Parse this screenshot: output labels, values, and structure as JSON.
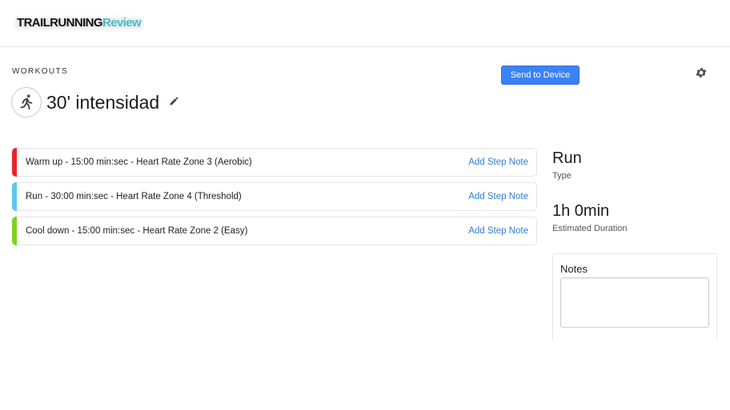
{
  "header": {
    "logo_part1": "TRAILRUNNING",
    "logo_part2": "Review"
  },
  "section_label": "WORKOUTS",
  "send_button_label": "Send to Device",
  "workout": {
    "title": "30' intensidad",
    "icon": "runner-icon"
  },
  "steps": [
    {
      "description": "Warm up - 15:00 min:sec - Heart Rate Zone 3 (Aerobic)",
      "note_label": "Add Step Note",
      "color": "#e8262a"
    },
    {
      "description": "Run - 30:00 min:sec - Heart Rate Zone 4 (Threshold)",
      "note_label": "Add Step Note",
      "color": "#5bc8ef"
    },
    {
      "description": "Cool down - 15:00 min:sec - Heart Rate Zone 2 (Easy)",
      "note_label": "Add Step Note",
      "color": "#7ed321"
    }
  ],
  "info": {
    "type_value": "Run",
    "type_label": "Type",
    "duration_value": "1h 0min",
    "duration_label": "Estimated Duration"
  },
  "notes": {
    "title": "Notes",
    "value": ""
  },
  "colors": {
    "accent": "#3b82f6",
    "link": "#2f7ed8"
  }
}
